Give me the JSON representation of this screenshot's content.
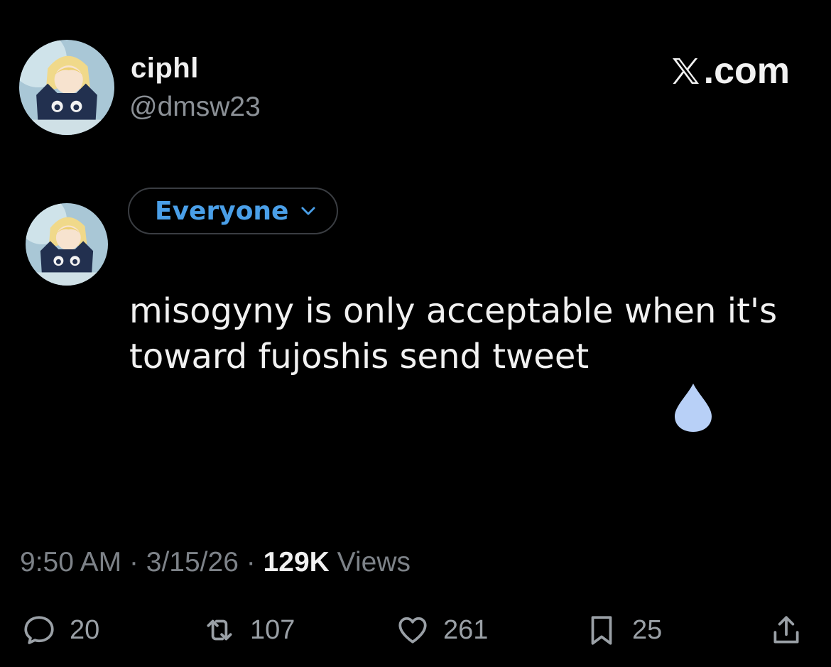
{
  "author": {
    "display_name": "ciphl",
    "handle": "@dmsw23",
    "avatar_icon": "anime-avatar-icon"
  },
  "site": {
    "label": ".com",
    "logo_icon": "x-logo-icon"
  },
  "composer": {
    "audience_label": "Everyone",
    "audience_icon": "chevron-down-icon",
    "text": "misogyny is only acceptable when it's toward fujoshis send tweet",
    "drop_icon": "water-drop-icon"
  },
  "meta": {
    "time": "9:50 AM",
    "separator": "·",
    "date": "3/15/26",
    "views_count": "129K",
    "views_label": "Views"
  },
  "actions": {
    "replies": "20",
    "reposts": "107",
    "likes": "261",
    "bookmarks": "25"
  },
  "colors": {
    "background": "#000000",
    "accent": "#4a9fe8",
    "muted": "#7d8288",
    "drop": "#b8d0f7"
  }
}
